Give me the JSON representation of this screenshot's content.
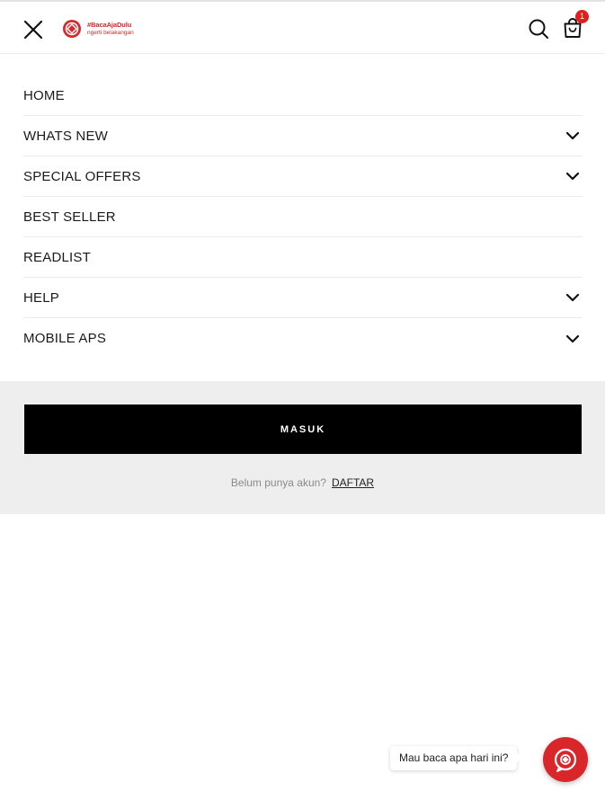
{
  "header": {
    "logo_line1": "#BacaAjaDulu",
    "logo_line2": "ngerti belakangan",
    "cart_count": "1"
  },
  "menu": {
    "items": [
      {
        "label": "HOME",
        "has_submenu": false
      },
      {
        "label": "WHATS NEW",
        "has_submenu": true
      },
      {
        "label": "SPECIAL OFFERS",
        "has_submenu": true
      },
      {
        "label": "BEST SELLER",
        "has_submenu": false
      },
      {
        "label": "READLIST",
        "has_submenu": false
      },
      {
        "label": "HELP",
        "has_submenu": true
      },
      {
        "label": "MOBILE APS",
        "has_submenu": true
      }
    ]
  },
  "login": {
    "button_label": "MASUK",
    "prompt": "Belum punya akun?",
    "register_link": "DAFTAR"
  },
  "chat": {
    "bubble_text": "Mau baca apa hari ini?"
  },
  "colors": {
    "brand_red": "#d9262a",
    "badge_red": "#e02020",
    "panel_bg": "#eeeeee",
    "button_bg": "#000000"
  },
  "icons": {
    "close": "close-icon",
    "search": "search-icon",
    "cart": "shopping-bag-icon",
    "chevron": "chevron-down-icon",
    "chat": "chat-icon"
  }
}
